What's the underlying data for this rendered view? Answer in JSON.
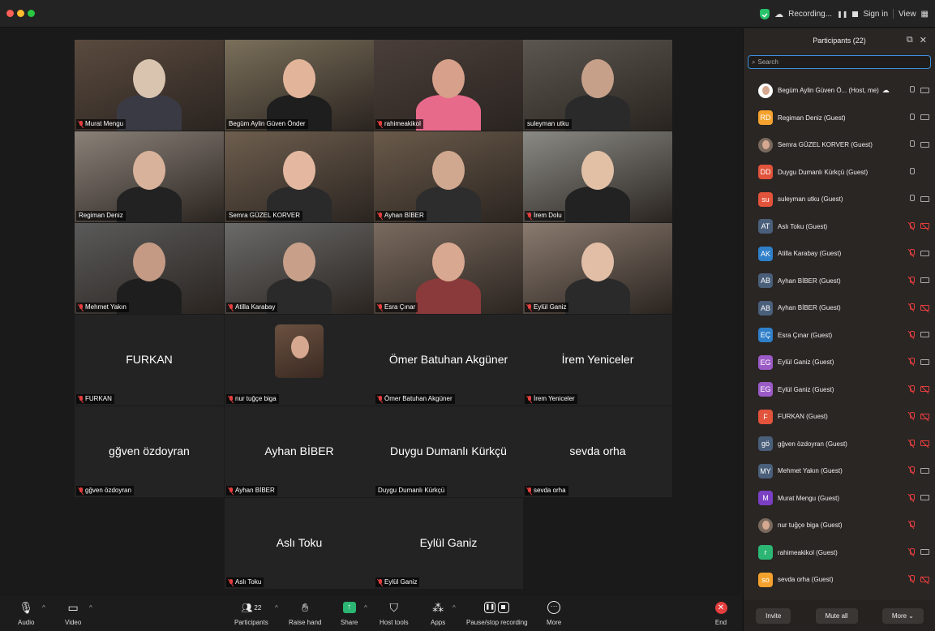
{
  "window": {
    "recording": "Recording...",
    "sign_in": "Sign in",
    "view": "View"
  },
  "tiles": [
    {
      "name": "Murat Mengu",
      "muted": true,
      "video": true
    },
    {
      "name": "Begüm Aylin Güven Önder",
      "muted": false,
      "video": true,
      "active": true
    },
    {
      "name": "rahimeakikol",
      "muted": true,
      "video": true
    },
    {
      "name": "suleyman utku",
      "muted": false,
      "video": true
    },
    {
      "name": "Regiman Deniz",
      "muted": false,
      "video": true
    },
    {
      "name": "Semra GÜZEL KORVER",
      "muted": false,
      "video": true
    },
    {
      "name": "Ayhan BİBER",
      "muted": true,
      "video": true
    },
    {
      "name": "İrem Dolu",
      "muted": true,
      "video": true
    },
    {
      "name": "Mehmet Yakın",
      "muted": true,
      "video": true
    },
    {
      "name": "Atilla Karabay",
      "muted": true,
      "video": true
    },
    {
      "name": "Esra Çınar",
      "muted": true,
      "video": true
    },
    {
      "name": "Eylül Ganiz",
      "muted": true,
      "video": true
    },
    {
      "name": "FURKAN",
      "display": "FURKAN",
      "muted": true
    },
    {
      "name": "nur tuğçe biga",
      "muted": true,
      "photo": true
    },
    {
      "name": "Ömer Batuhan Akgüner",
      "display": "Ömer Batuhan Akgüner",
      "muted": true
    },
    {
      "name": "İrem Yeniceler",
      "display": "İrem Yeniceler",
      "muted": true
    },
    {
      "name": "gğven özdoyran",
      "display": "gğven özdoyran",
      "muted": true
    },
    {
      "name": "Ayhan BİBER",
      "display": "Ayhan BİBER",
      "muted": true
    },
    {
      "name": "Duygu Dumanlı Kürkçü",
      "display": "Duygu Dumanlı Kürkçü",
      "muted": false
    },
    {
      "name": "sevda orha",
      "display": "sevda orha",
      "muted": true
    },
    {
      "name": "Aslı Toku",
      "display": "Aslı Toku",
      "muted": true
    },
    {
      "name": "Eylül Ganiz",
      "display": "Eylül Ganiz",
      "muted": true
    }
  ],
  "toolbar": {
    "audio": "Audio",
    "video": "Video",
    "participants": "Participants",
    "participants_count": "22",
    "raise_hand": "Raise hand",
    "share": "Share",
    "host_tools": "Host tools",
    "apps": "Apps",
    "pause_stop": "Pause/stop recording",
    "more": "More",
    "end": "End"
  },
  "panel": {
    "title": "Participants (22)",
    "search_placeholder": "Search",
    "participants": [
      {
        "initials": "",
        "name": "Begüm Aylin Güven Ö...  (Host, me)",
        "color": "#ffffff",
        "photo": true,
        "mic": "on",
        "cam": "on",
        "cloud": true
      },
      {
        "initials": "RD",
        "name": "Regiman Deniz (Guest)",
        "color": "#f4a22d",
        "mic": "on",
        "cam": "on"
      },
      {
        "initials": "",
        "name": "Semra GÜZEL KORVER (Guest)",
        "color": "#7a6a5e",
        "photo": true,
        "mic": "on",
        "cam": "on"
      },
      {
        "initials": "DD",
        "name": "Duygu Dumanlı Kürkçü (Guest)",
        "color": "#e2533b",
        "mic": "on",
        "cam": "none"
      },
      {
        "initials": "su",
        "name": "suleyman utku (Guest)",
        "color": "#e2533b",
        "mic": "on",
        "cam": "on"
      },
      {
        "initials": "AT",
        "name": "Aslı Toku (Guest)",
        "color": "#4a5f7a",
        "mic": "off",
        "cam": "off"
      },
      {
        "initials": "AK",
        "name": "Atilla Karabay (Guest)",
        "color": "#2f7fc9",
        "mic": "off",
        "cam": "on"
      },
      {
        "initials": "AB",
        "name": "Ayhan BİBER (Guest)",
        "color": "#4a5f7a",
        "mic": "off",
        "cam": "on"
      },
      {
        "initials": "AB",
        "name": "Ayhan BİBER (Guest)",
        "color": "#4a5f7a",
        "mic": "off",
        "cam": "off"
      },
      {
        "initials": "EÇ",
        "name": "Esra Çınar (Guest)",
        "color": "#2f7fc9",
        "mic": "off",
        "cam": "on"
      },
      {
        "initials": "EG",
        "name": "Eylül Ganiz (Guest)",
        "color": "#9b5bc7",
        "mic": "off",
        "cam": "on"
      },
      {
        "initials": "EG",
        "name": "Eylül Ganiz (Guest)",
        "color": "#9b5bc7",
        "mic": "off",
        "cam": "off"
      },
      {
        "initials": "F",
        "name": "FURKAN (Guest)",
        "color": "#e2533b",
        "mic": "off",
        "cam": "off"
      },
      {
        "initials": "gö",
        "name": "gğven özdoyran (Guest)",
        "color": "#4a5f7a",
        "mic": "off",
        "cam": "off"
      },
      {
        "initials": "MY",
        "name": "Mehmet Yakın (Guest)",
        "color": "#4a5f7a",
        "mic": "off",
        "cam": "on"
      },
      {
        "initials": "M",
        "name": "Murat Mengu (Guest)",
        "color": "#7b3fc4",
        "mic": "off",
        "cam": "on"
      },
      {
        "initials": "",
        "name": "nur tuğçe biga (Guest)",
        "color": "#7a6a5e",
        "photo": true,
        "mic": "off",
        "cam": "none"
      },
      {
        "initials": "r",
        "name": "rahimeakikol (Guest)",
        "color": "#2bb673",
        "mic": "off",
        "cam": "on"
      },
      {
        "initials": "so",
        "name": "sevda orha (Guest)",
        "color": "#f4a22d",
        "mic": "off",
        "cam": "off"
      }
    ],
    "invite": "Invite",
    "mute_all": "Mute all",
    "more": "More"
  },
  "colors": {
    "accent_blue": "#3b8fd9",
    "muted_red": "#e53e3e",
    "active_green": "#34c759"
  }
}
